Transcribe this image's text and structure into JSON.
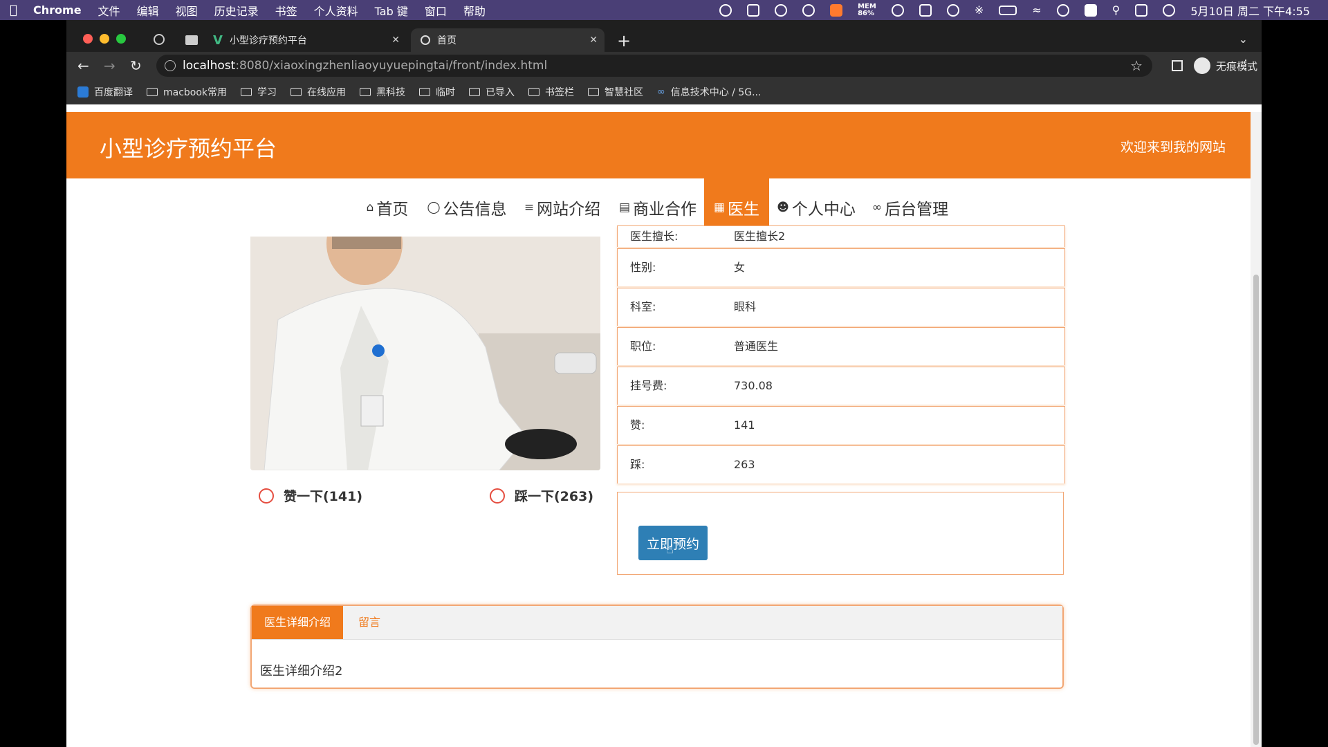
{
  "menubar": {
    "app": "Chrome",
    "items": [
      "文件",
      "编辑",
      "视图",
      "历史记录",
      "书签",
      "个人资料",
      "Tab 键",
      "窗口",
      "帮助"
    ],
    "mem_label": "MEM",
    "mem_value": "86%",
    "clock": "5月10日 周二 下午4:55"
  },
  "browser": {
    "tabs": [
      {
        "title": "小型诊疗预约平台"
      },
      {
        "title": "首页"
      }
    ],
    "url_host": "localhost",
    "url_path": ":8080/xiaoxingzhenliaoyuyuepingtai/front/index.html",
    "profile_label": "无痕模式",
    "bookmarks": [
      "百度翻译",
      "macbook常用",
      "学习",
      "在线应用",
      "黑科技",
      "临时",
      "已导入",
      "书签栏",
      "智慧社区",
      "信息技术中心 / 5G..."
    ]
  },
  "site": {
    "title": "小型诊疗预约平台",
    "welcome": "欢迎来到我的网站",
    "nav": [
      {
        "label": "首页",
        "icon": "home-icon"
      },
      {
        "label": "公告信息",
        "icon": "tag-icon"
      },
      {
        "label": "网站介绍",
        "icon": "sliders-icon"
      },
      {
        "label": "商业合作",
        "icon": "gift-icon"
      },
      {
        "label": "医生",
        "icon": "hospital-icon"
      },
      {
        "label": "个人中心",
        "icon": "user-icon"
      },
      {
        "label": "后台管理",
        "icon": "link-icon"
      }
    ],
    "accent_color": "#f07a1c"
  },
  "doctor": {
    "partial_row_label": "医生擅长:",
    "partial_row_value": "医生擅长2",
    "rows": [
      {
        "label": "性别:",
        "value": "女"
      },
      {
        "label": "科室:",
        "value": "眼科"
      },
      {
        "label": "职位:",
        "value": "普通医生"
      },
      {
        "label": "挂号费:",
        "value": "730.08"
      },
      {
        "label": "赞:",
        "value": "141"
      },
      {
        "label": "踩:",
        "value": "263"
      }
    ],
    "like_label": "赞一下(141)",
    "dislike_label": "踩一下(263)",
    "book_button": "立即预约"
  },
  "detail_tabs": {
    "tabs": [
      "医生详细介绍",
      "留言"
    ],
    "content": "医生详细介绍2"
  }
}
